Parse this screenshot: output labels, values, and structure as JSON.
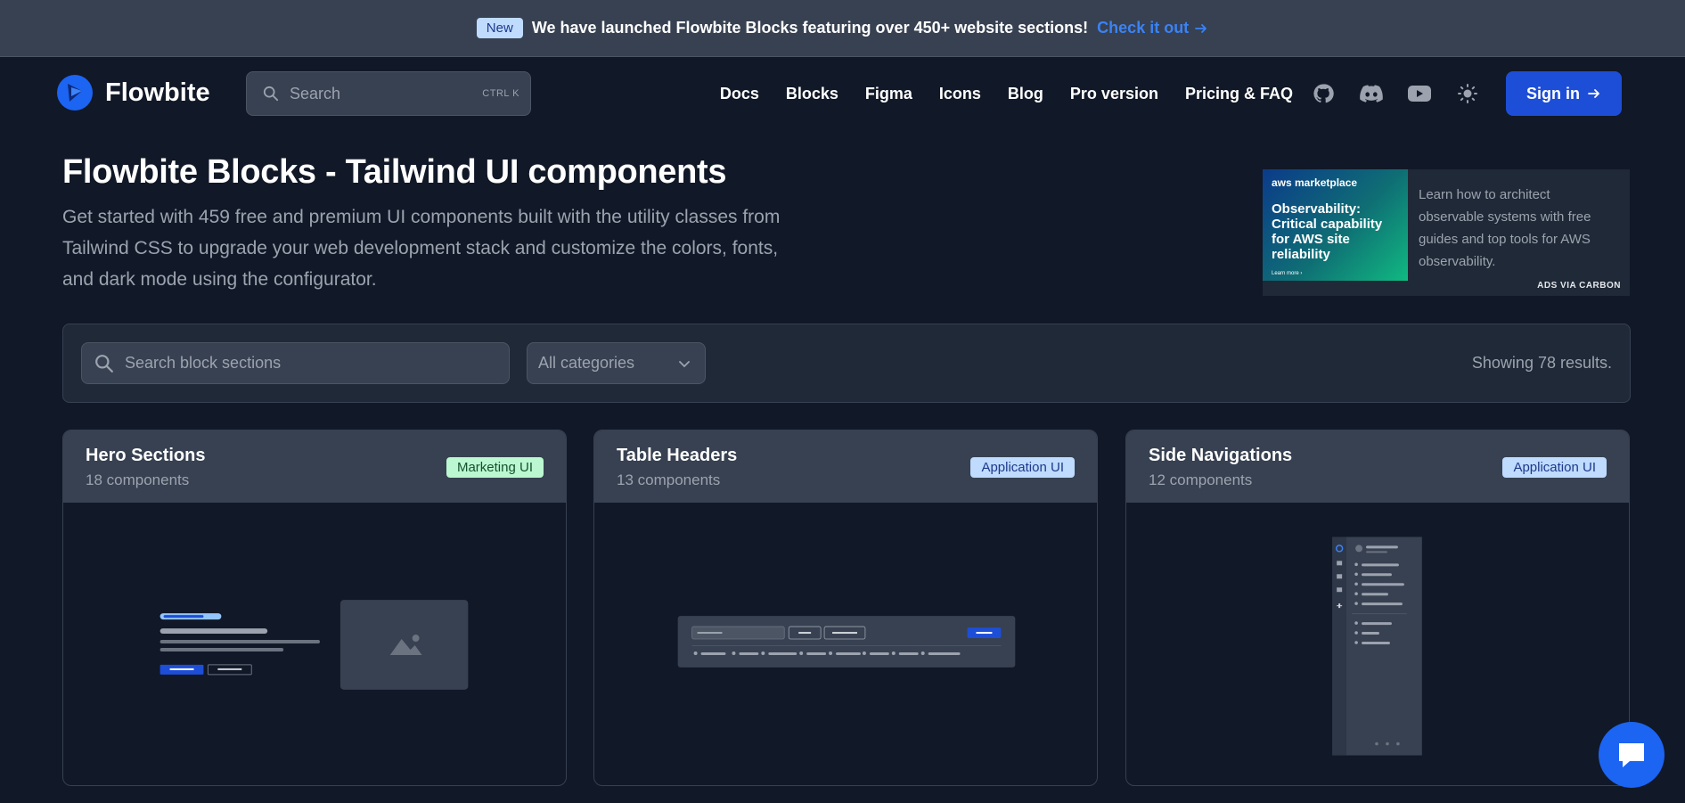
{
  "banner": {
    "badge": "New",
    "message": "We have launched Flowbite Blocks featuring over 450+ website sections!",
    "link": "Check it out"
  },
  "nav": {
    "brand": "Flowbite",
    "search_placeholder": "Search",
    "search_shortcut": "CTRL K",
    "links": [
      "Docs",
      "Blocks",
      "Figma",
      "Icons",
      "Blog",
      "Pro version",
      "Pricing & FAQ"
    ],
    "icons": [
      "github-icon",
      "discord-icon",
      "youtube-icon",
      "sun-icon"
    ],
    "signin": "Sign in"
  },
  "hero": {
    "title": "Flowbite Blocks - Tailwind UI components",
    "description": "Get started with 459 free and premium UI components built with the utility classes from Tailwind CSS to upgrade your web development stack and customize the colors, fonts, and dark mode using the configurator."
  },
  "ad": {
    "brand": "aws marketplace",
    "headline": "Observability: Critical capability for AWS site reliability",
    "cta": "Learn more ›",
    "text": "Learn how to architect observable systems with free guides and top tools for AWS observability.",
    "via": "ADS VIA CARBON"
  },
  "filter": {
    "search_placeholder": "Search block sections",
    "category": "All categories",
    "results": "Showing 78 results."
  },
  "cards": [
    {
      "title": "Hero Sections",
      "count": "18 components",
      "tag": "Marketing UI"
    },
    {
      "title": "Table Headers",
      "count": "13 components",
      "tag": "Application UI"
    },
    {
      "title": "Side Navigations",
      "count": "12 components",
      "tag": "Application UI"
    }
  ],
  "colors": {
    "background": "#111827",
    "accent": "#1d4ed8",
    "link": "#3b82f6"
  }
}
